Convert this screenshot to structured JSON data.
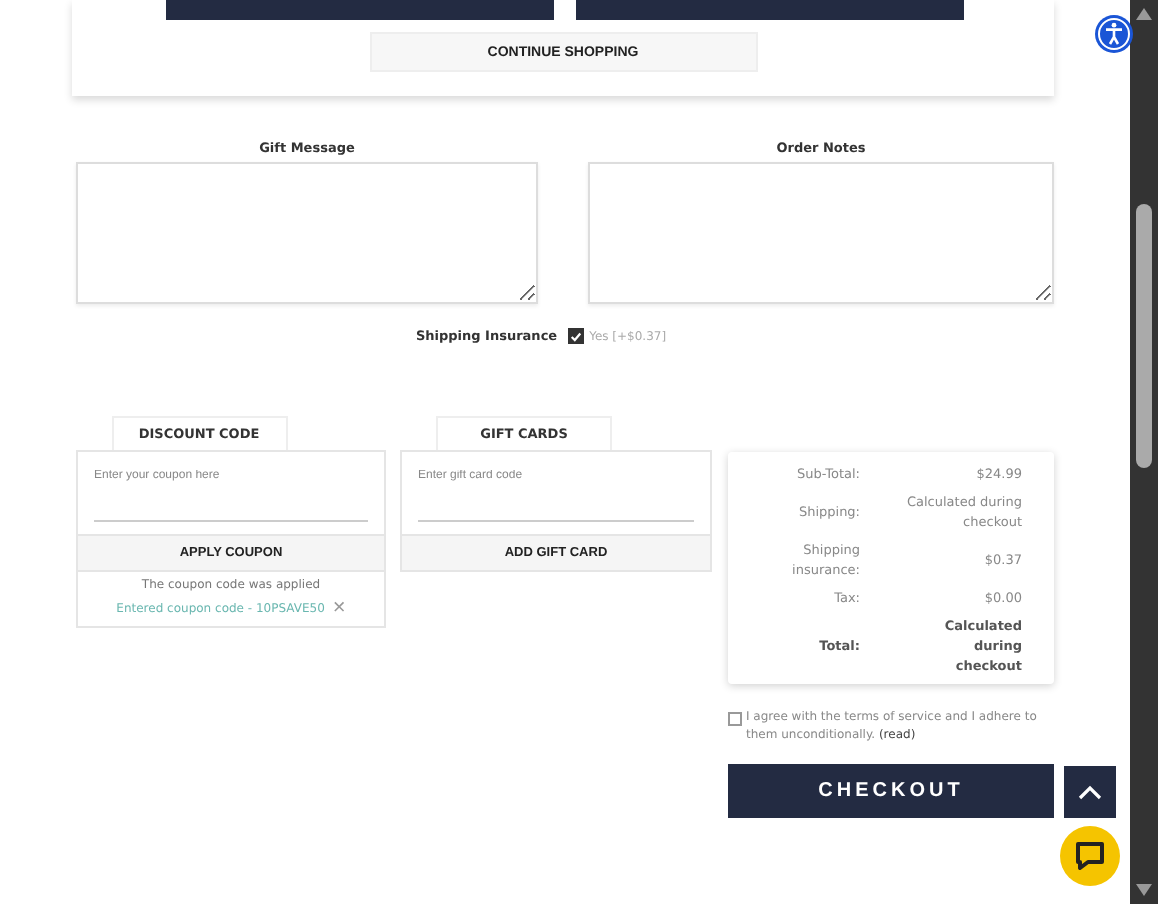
{
  "cart_actions": {
    "continue_button": "CONTINUE SHOPPING"
  },
  "fields": [
    {
      "label": "Gift Message"
    },
    {
      "label": "Order Notes"
    }
  ],
  "shipping_insurance": {
    "label": "Shipping Insurance",
    "checked": true,
    "option": "Yes [+$0.37]"
  },
  "discount": {
    "tab": "DISCOUNT CODE",
    "placeholder": "Enter your coupon here",
    "button": "APPLY COUPON",
    "message": "The coupon code was applied",
    "entered": "Entered coupon code - 10PSAVE50",
    "remove": "×"
  },
  "gift_cards": {
    "tab": "GIFT CARDS",
    "placeholder": "Enter gift card code",
    "button": "ADD GIFT CARD"
  },
  "summary": [
    {
      "label": "Sub-Total:",
      "value": "$24.99",
      "kind": "normal"
    },
    {
      "label": "Shipping:",
      "value": "Calculated during checkout",
      "kind": "normal"
    },
    {
      "label": "Shipping insurance:",
      "value": "$0.37",
      "kind": "normal"
    },
    {
      "label": "Tax:",
      "value": "$0.00",
      "kind": "normal"
    },
    {
      "label": "Total:",
      "value": "Calculated during checkout",
      "kind": "total"
    }
  ],
  "terms": {
    "checked": false,
    "text": "I agree with the terms of service and I adhere to them unconditionally.",
    "link": "(read)"
  },
  "checkout_button": "CHECKOUT"
}
